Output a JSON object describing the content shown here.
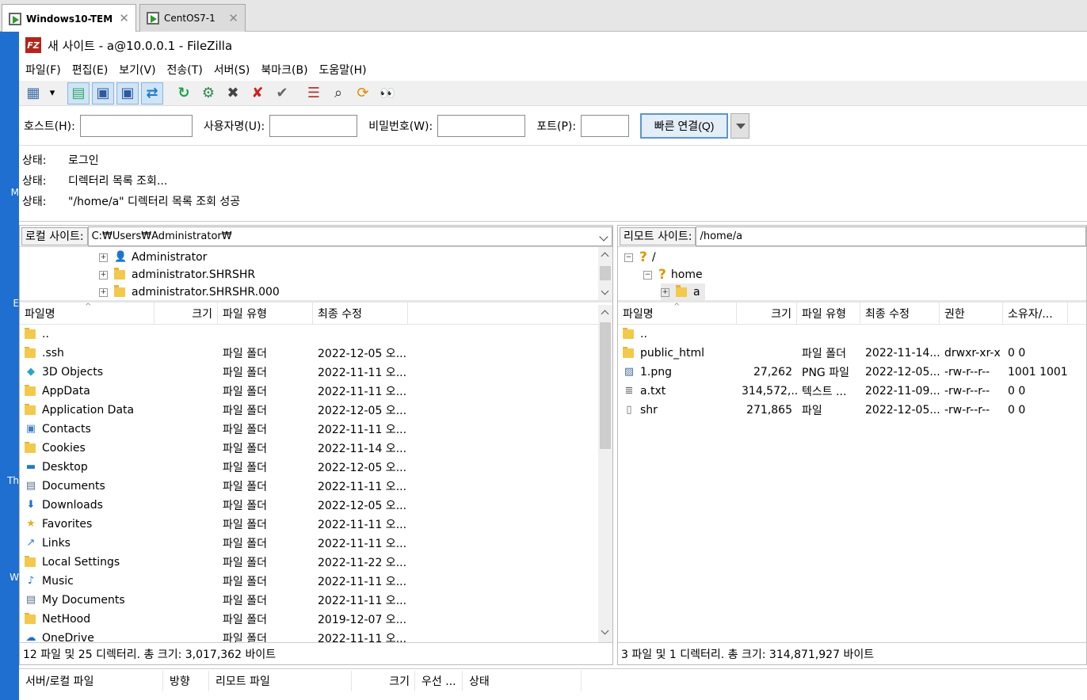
{
  "vm_tabs": [
    {
      "label": "Windows10-TEM",
      "active": true
    },
    {
      "label": "CentOS7-1",
      "active": false
    }
  ],
  "desktop_labels": [
    "M",
    "E",
    "Th",
    "W"
  ],
  "window": {
    "title": "새 사이트 - a@10.0.0.1 - FileZilla",
    "logo": "FZ"
  },
  "menu": [
    "파일(F)",
    "편집(E)",
    "보기(V)",
    "전송(T)",
    "서버(S)",
    "북마크(B)",
    "도움말(H)"
  ],
  "toolbar": [
    {
      "name": "site-manager-icon",
      "glyph": "▦"
    },
    {
      "name": "dropdown-arrow-icon",
      "glyph": "▾"
    },
    {
      "name": "toggle-log-icon",
      "glyph": "▤"
    },
    {
      "name": "toggle-local-tree-icon",
      "glyph": "▣"
    },
    {
      "name": "toggle-remote-tree-icon",
      "glyph": "▣"
    },
    {
      "name": "toggle-queue-icon",
      "glyph": "⇄"
    },
    {
      "name": "refresh-icon",
      "glyph": "↻"
    },
    {
      "name": "process-queue-icon",
      "glyph": "⚙"
    },
    {
      "name": "cancel-icon",
      "glyph": "✖"
    },
    {
      "name": "disconnect-icon",
      "glyph": "✘"
    },
    {
      "name": "reconnect-icon",
      "glyph": "✔"
    },
    {
      "name": "filter-icon",
      "glyph": "☰"
    },
    {
      "name": "search-icon",
      "glyph": "⌕"
    },
    {
      "name": "compare-icon",
      "glyph": "⟳"
    },
    {
      "name": "binoculars-icon",
      "glyph": "👀"
    }
  ],
  "quickconnect": {
    "host_label": "호스트(H):",
    "host": "",
    "user_label": "사용자명(U):",
    "user": "",
    "pass_label": "비밀번호(W):",
    "pass": "",
    "port_label": "포트(P):",
    "port": "",
    "button": "빠른 연결(Q)"
  },
  "log": [
    {
      "label": "상태:",
      "text": "로그인"
    },
    {
      "label": "상태:",
      "text": "디렉터리 목록 조회..."
    },
    {
      "label": "상태:",
      "text": "\"/home/a\" 디렉터리 목록 조회 성공"
    }
  ],
  "local": {
    "site_label": "로컬 사이트:",
    "path": "C:₩Users₩Administrator₩",
    "tree": [
      "Administrator",
      "administrator.SHRSHR",
      "administrator.SHRSHR.000"
    ],
    "columns": [
      "파일명",
      "크기",
      "파일 유형",
      "최종 수정"
    ],
    "files": [
      {
        "name": "..",
        "icon": "folder",
        "type": "",
        "modified": ""
      },
      {
        "name": ".ssh",
        "icon": "folder",
        "type": "파일 폴더",
        "modified": "2022-12-05 오..."
      },
      {
        "name": "3D Objects",
        "icon": "cube",
        "type": "파일 폴더",
        "modified": "2022-11-11 오..."
      },
      {
        "name": "AppData",
        "icon": "folder",
        "type": "파일 폴더",
        "modified": "2022-11-11 오..."
      },
      {
        "name": "Application Data",
        "icon": "folder",
        "type": "파일 폴더",
        "modified": "2022-12-05 오..."
      },
      {
        "name": "Contacts",
        "icon": "contacts",
        "type": "파일 폴더",
        "modified": "2022-11-11 오..."
      },
      {
        "name": "Cookies",
        "icon": "folder",
        "type": "파일 폴더",
        "modified": "2022-11-14 오..."
      },
      {
        "name": "Desktop",
        "icon": "desktop",
        "type": "파일 폴더",
        "modified": "2022-12-05 오..."
      },
      {
        "name": "Documents",
        "icon": "document",
        "type": "파일 폴더",
        "modified": "2022-11-11 오..."
      },
      {
        "name": "Downloads",
        "icon": "download",
        "type": "파일 폴더",
        "modified": "2022-12-05 오..."
      },
      {
        "name": "Favorites",
        "icon": "star",
        "type": "파일 폴더",
        "modified": "2022-11-11 오..."
      },
      {
        "name": "Links",
        "icon": "link",
        "type": "파일 폴더",
        "modified": "2022-11-11 오..."
      },
      {
        "name": "Local Settings",
        "icon": "folder",
        "type": "파일 폴더",
        "modified": "2022-11-22 오..."
      },
      {
        "name": "Music",
        "icon": "music",
        "type": "파일 폴더",
        "modified": "2022-11-11 오..."
      },
      {
        "name": "My Documents",
        "icon": "document",
        "type": "파일 폴더",
        "modified": "2022-11-11 오..."
      },
      {
        "name": "NetHood",
        "icon": "folder",
        "type": "파일 폴더",
        "modified": "2019-12-07 오..."
      },
      {
        "name": "OneDrive",
        "icon": "cloud",
        "type": "파일 폴더",
        "modified": "2022-11-11 오..."
      }
    ],
    "status": "12 파일 및 25 디렉터리. 총 크기: 3,017,362 바이트"
  },
  "remote": {
    "site_label": "리모트 사이트:",
    "path": "/home/a",
    "tree": [
      "/",
      "home",
      "a"
    ],
    "columns": [
      "파일명",
      "크기",
      "파일 유형",
      "최종 수정",
      "권한",
      "소유자/..."
    ],
    "files": [
      {
        "name": "..",
        "icon": "folder",
        "size": "",
        "type": "",
        "modified": "",
        "perm": "",
        "owner": ""
      },
      {
        "name": "public_html",
        "icon": "folder",
        "size": "",
        "type": "파일 폴더",
        "modified": "2022-11-14...",
        "perm": "drwxr-xr-x",
        "owner": "0 0"
      },
      {
        "name": "1.png",
        "icon": "image",
        "size": "27,262",
        "type": "PNG 파일",
        "modified": "2022-12-05...",
        "perm": "-rw-r--r--",
        "owner": "1001 1001"
      },
      {
        "name": "a.txt",
        "icon": "text",
        "size": "314,572,...",
        "type": "텍스트 ...",
        "modified": "2022-11-09...",
        "perm": "-rw-r--r--",
        "owner": "0 0"
      },
      {
        "name": "shr",
        "icon": "file",
        "size": "271,865",
        "type": "파일",
        "modified": "2022-12-05...",
        "perm": "-rw-r--r--",
        "owner": "0 0"
      }
    ],
    "status": "3 파일 및 1 디렉터리. 총 크기: 314,871,927 바이트"
  },
  "queue": {
    "columns": [
      "서버/로컬 파일",
      "방향",
      "리모트 파일",
      "크기",
      "우선 ...",
      "상태"
    ]
  }
}
